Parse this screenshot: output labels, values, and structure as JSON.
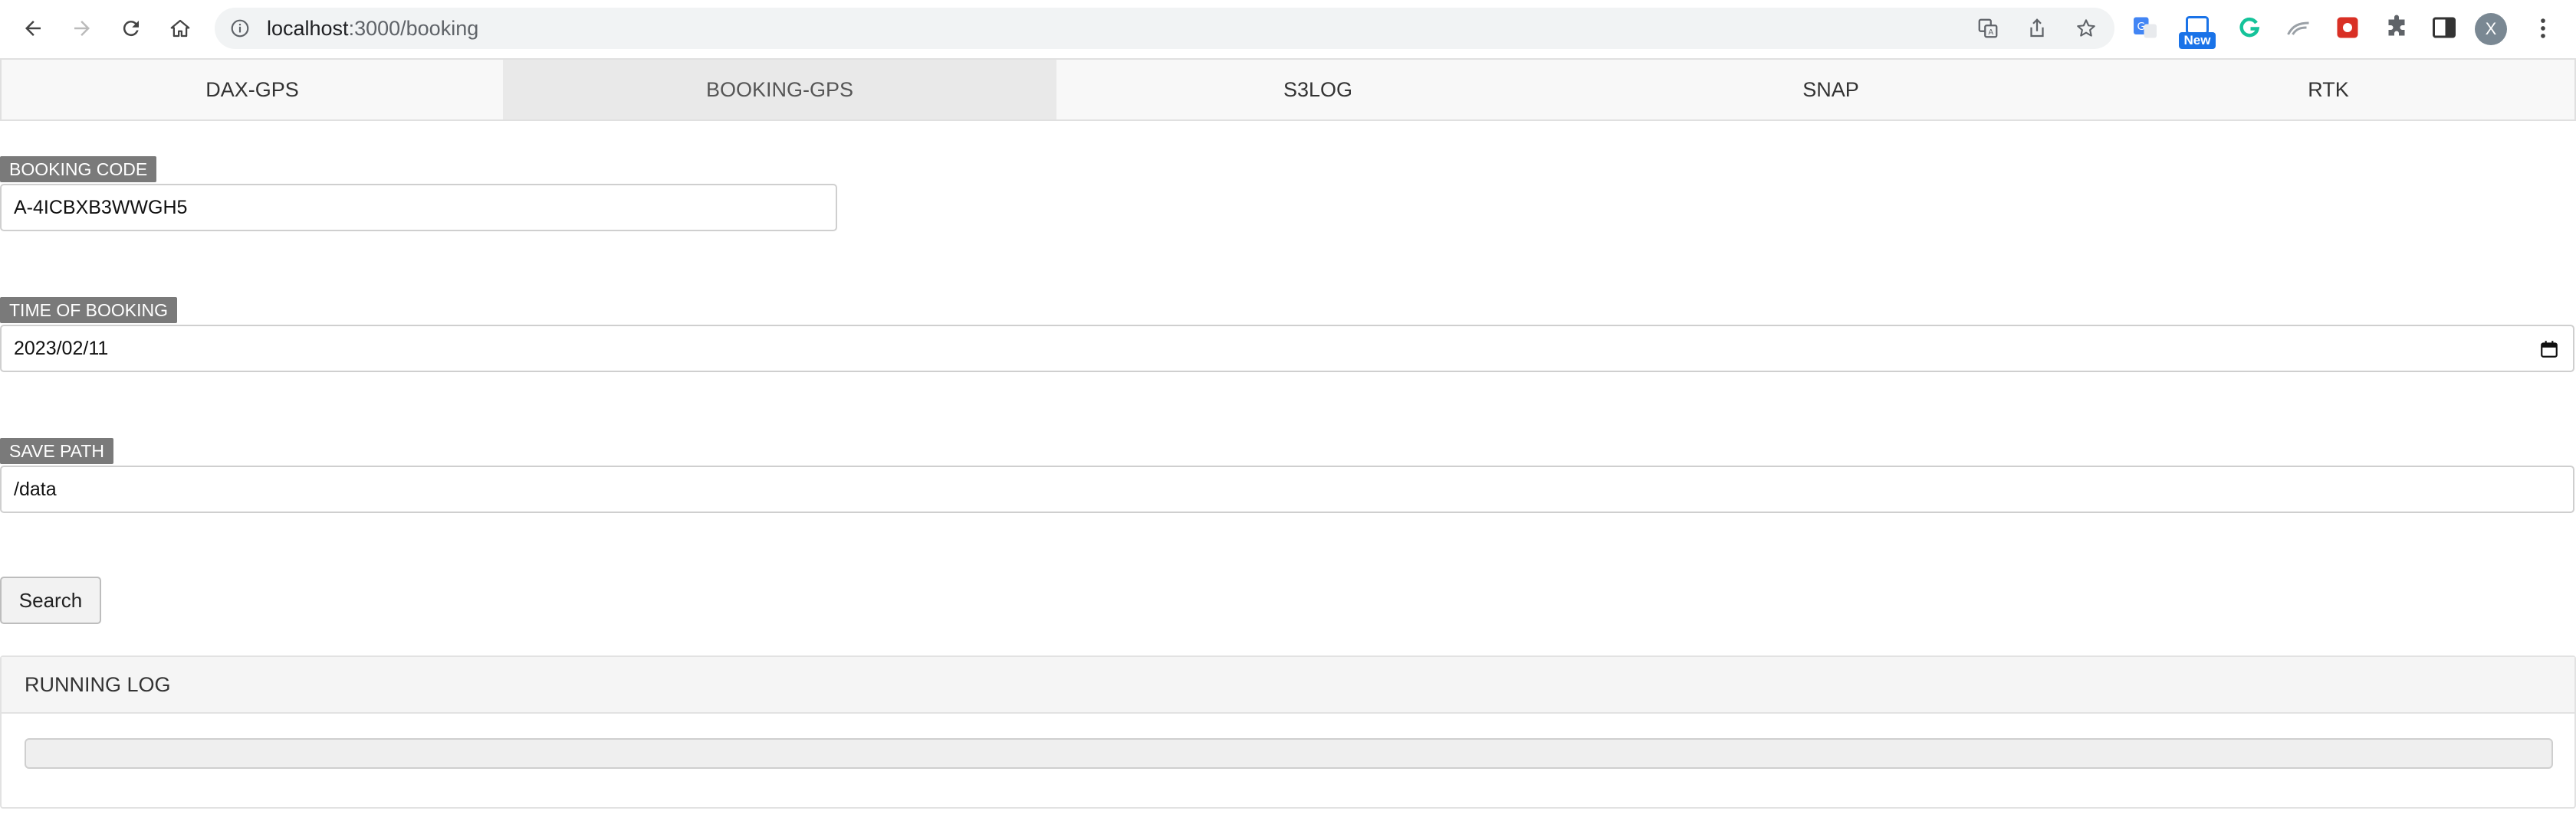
{
  "browser": {
    "url_host": "localhost",
    "url_path": ":3000/booking",
    "extension_badge": "New",
    "profile_initial": "X"
  },
  "tabs": [
    {
      "label": "DAX-GPS",
      "active": false
    },
    {
      "label": "BOOKING-GPS",
      "active": true
    },
    {
      "label": "S3LOG",
      "active": false
    },
    {
      "label": "SNAP",
      "active": false
    },
    {
      "label": "RTK",
      "active": false
    }
  ],
  "form": {
    "booking_code": {
      "label": "BOOKING CODE",
      "value": "A-4ICBXB3WWGH5"
    },
    "time_of_booking": {
      "label": "TIME OF BOOKING",
      "value": "2023/02/11"
    },
    "save_path": {
      "label": "SAVE PATH",
      "value": "/data"
    },
    "search_label": "Search"
  },
  "log": {
    "title": "RUNNING LOG"
  },
  "colors": {
    "label_bg": "#7a7a7a",
    "active_tab_bg": "#e9e9e9",
    "accent_blue": "#1a73e8"
  }
}
